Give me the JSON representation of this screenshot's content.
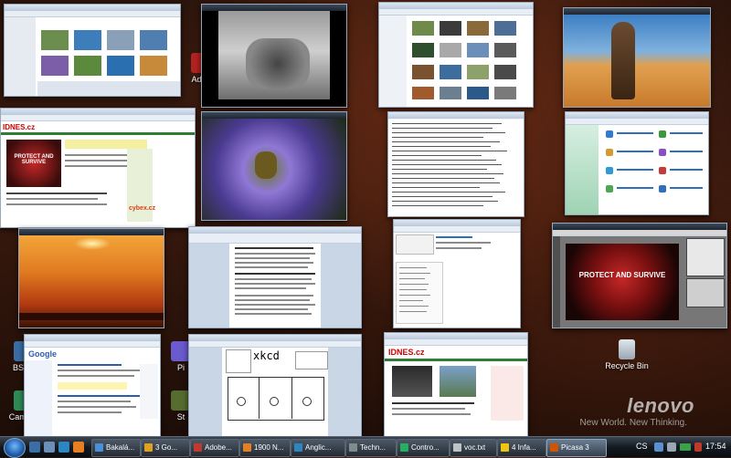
{
  "desktop": {
    "icons": [
      {
        "label": "BSpla",
        "color": "#3a6ea5"
      },
      {
        "label": "CamStu",
        "color": "#2e8b57"
      },
      {
        "label": "Adob",
        "color": "#b22222"
      },
      {
        "label": "Pi",
        "color": "#6a5acd"
      },
      {
        "label": "St",
        "color": "#556b2f"
      }
    ],
    "recycle_bin": "Recycle Bin",
    "brand": "lenovo",
    "brand_tagline": "New World. New Thinking."
  },
  "windows": {
    "xkcd_logo": "xkcd",
    "protect_poster_text": "PROTECT AND SURVIVE",
    "protect_small_text": "PROTECT AND SURVIVE",
    "idnes_logo": "IDNES.cz",
    "idnes_logo_small": "IDNES.cz",
    "google_logo": "Google",
    "cyber_logo": "cybex.cz"
  },
  "taskbar": {
    "tasks": [
      {
        "label": "Bakalá...",
        "color": "#4a8fd8"
      },
      {
        "label": "3 Go...",
        "color": "#e0a020"
      },
      {
        "label": "Adobe...",
        "color": "#c0392b"
      },
      {
        "label": "1900 N...",
        "color": "#e67e22"
      },
      {
        "label": "Anglic...",
        "color": "#2e86c1"
      },
      {
        "label": "Techn...",
        "color": "#7f8c8d"
      },
      {
        "label": "Contro...",
        "color": "#27ae60"
      },
      {
        "label": "voc.txt",
        "color": "#bdc3c7"
      },
      {
        "label": "4 Infa...",
        "color": "#f1c40f"
      },
      {
        "label": "Picasa 3",
        "color": "#d35400"
      }
    ],
    "lang": "CS",
    "clock": "17:54"
  }
}
